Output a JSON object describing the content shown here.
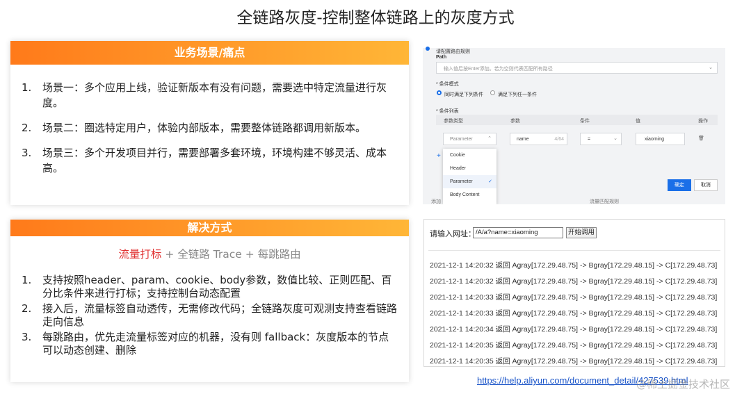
{
  "title": "全链路灰度-控制整体链路上的灰度方式",
  "scenarios_card": {
    "header": "业务场景/痛点",
    "items": [
      {
        "num": "1.",
        "text": "场景一：多个应用上线，验证新版本有没有问题，需要选中特定流量进行灰度。"
      },
      {
        "num": "2.",
        "text": "场景二：圈选特定用户，体验内部版本，需要整体链路都调用新版本。"
      },
      {
        "num": "3.",
        "text": "场景三：多个开发项目并行，需要部署多套环境，环境构建不够灵活、成本高。"
      }
    ]
  },
  "solution_card": {
    "header": "解决方式",
    "formula_highlight": "流量打标",
    "formula_rest": " + 全链路 Trace + 每跳路由",
    "items": [
      {
        "num": "1.",
        "text": "支持按照header、param、cookie、body参数，数值比较、正则匹配、百分比条件来进行打标；支持控制台动态配置"
      },
      {
        "num": "2.",
        "text": "接入后，流量标签自动透传，无需修改代码；全链路灰度可观测支持查看链路走向信息"
      },
      {
        "num": "3.",
        "text": "每跳路由，优先走流量标签对应的机器，没有则 fallback：灰度版本的节点可以动态创建、删除"
      }
    ]
  },
  "route_config": {
    "section_title": "请配置路由规则",
    "path_label": "Path",
    "path_placeholder": "输入值后按Enter添加。若为空则代表匹配所有路径",
    "condition_mode_label": "* 条件模式",
    "mode_all": "同时满足下列条件",
    "mode_any": "满足下列任一条件",
    "condition_list_label": "* 条件列表",
    "col_param_type": "参数类型",
    "col_param": "参数",
    "col_condition": "条件",
    "col_value": "值",
    "col_action": "操作",
    "param_type_value": "Parameter",
    "param_value": "name",
    "param_counter": "4/64",
    "condition_value": "=",
    "value_value": "xiaoming",
    "delete_icon_glyph": "🗑",
    "add_glyph": "+",
    "dropdown_options": [
      "Cookie",
      "Header",
      "Parameter",
      "Body Content"
    ],
    "dropdown_selected": "Parameter",
    "confirm_label": "确定",
    "cancel_label": "取消",
    "footer_left": "添加",
    "footer_right": "流量匹配规则"
  },
  "log_panel": {
    "url_label": "请输入网址：",
    "url_value": "/A/a?name=xiaoming",
    "start_button": "开始调用",
    "lines": [
      "2021-12-1 14:20:32 返回 Agray[172.29.48.75] -> Bgray[172.29.48.15] -> C[172.29.48.73]",
      "2021-12-1 14:20:32 返回 Agray[172.29.48.75] -> Bgray[172.29.48.15] -> C[172.29.48.73]",
      "2021-12-1 14:20:33 返回 Agray[172.29.48.75] -> Bgray[172.29.48.15] -> C[172.29.48.73]",
      "2021-12-1 14:20:33 返回 Agray[172.29.48.75] -> Bgray[172.29.48.15] -> C[172.29.48.73]",
      "2021-12-1 14:20:34 返回 Agray[172.29.48.75] -> Bgray[172.29.48.15] -> C[172.29.48.73]",
      "2021-12-1 14:20:35 返回 Agray[172.29.48.75] -> Bgray[172.29.48.15] -> C[172.29.48.73]",
      "2021-12-1 14:20:35 返回 Agray[172.29.48.75] -> Bgray[172.29.48.15] -> C[172.29.48.73]"
    ]
  },
  "source_link": "https://help.aliyun.com/document_detail/427539.html",
  "watermark": "@稀土掘金技术社区",
  "colors": {
    "accent_start": "#ff7a1a",
    "accent_end": "#ffb637",
    "highlight_red": "#e03030",
    "primary_blue": "#1a6fe8"
  }
}
